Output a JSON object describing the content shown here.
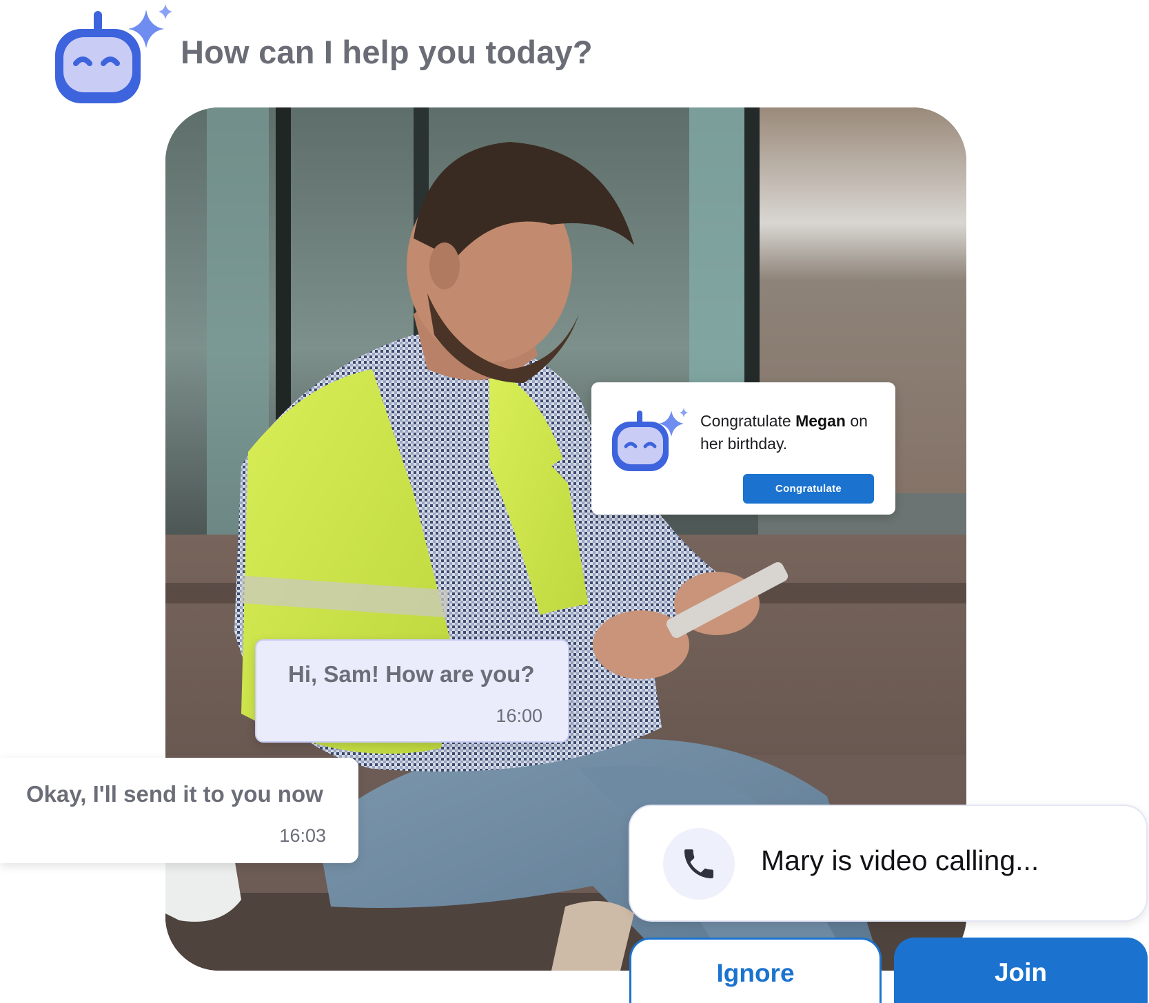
{
  "header": {
    "title": "How can I help you today?",
    "bot_icon": "robot-assistant-icon"
  },
  "notification": {
    "text_before": "Congratulate ",
    "name": "Megan",
    "text_after": " on",
    "text_line2": "her birthday.",
    "button_label": "Congratulate",
    "bot_icon": "robot-assistant-icon"
  },
  "chat": {
    "incoming": {
      "message": "Hi, Sam! How are you?",
      "time": "16:00"
    },
    "outgoing": {
      "message": "Okay, I'll send it to you now",
      "time": "16:03"
    }
  },
  "call": {
    "text": "Mary is video calling...",
    "icon": "phone-icon",
    "ignore_label": "Ignore",
    "join_label": "Join"
  },
  "colors": {
    "accent_blue": "#1b73cf",
    "bot_blue": "#3d63dd",
    "bot_face": "#c9cdf6",
    "sparkle": "#6f8df0",
    "bubble_bg": "#eaecfb",
    "text_gray": "#6b6e78"
  }
}
